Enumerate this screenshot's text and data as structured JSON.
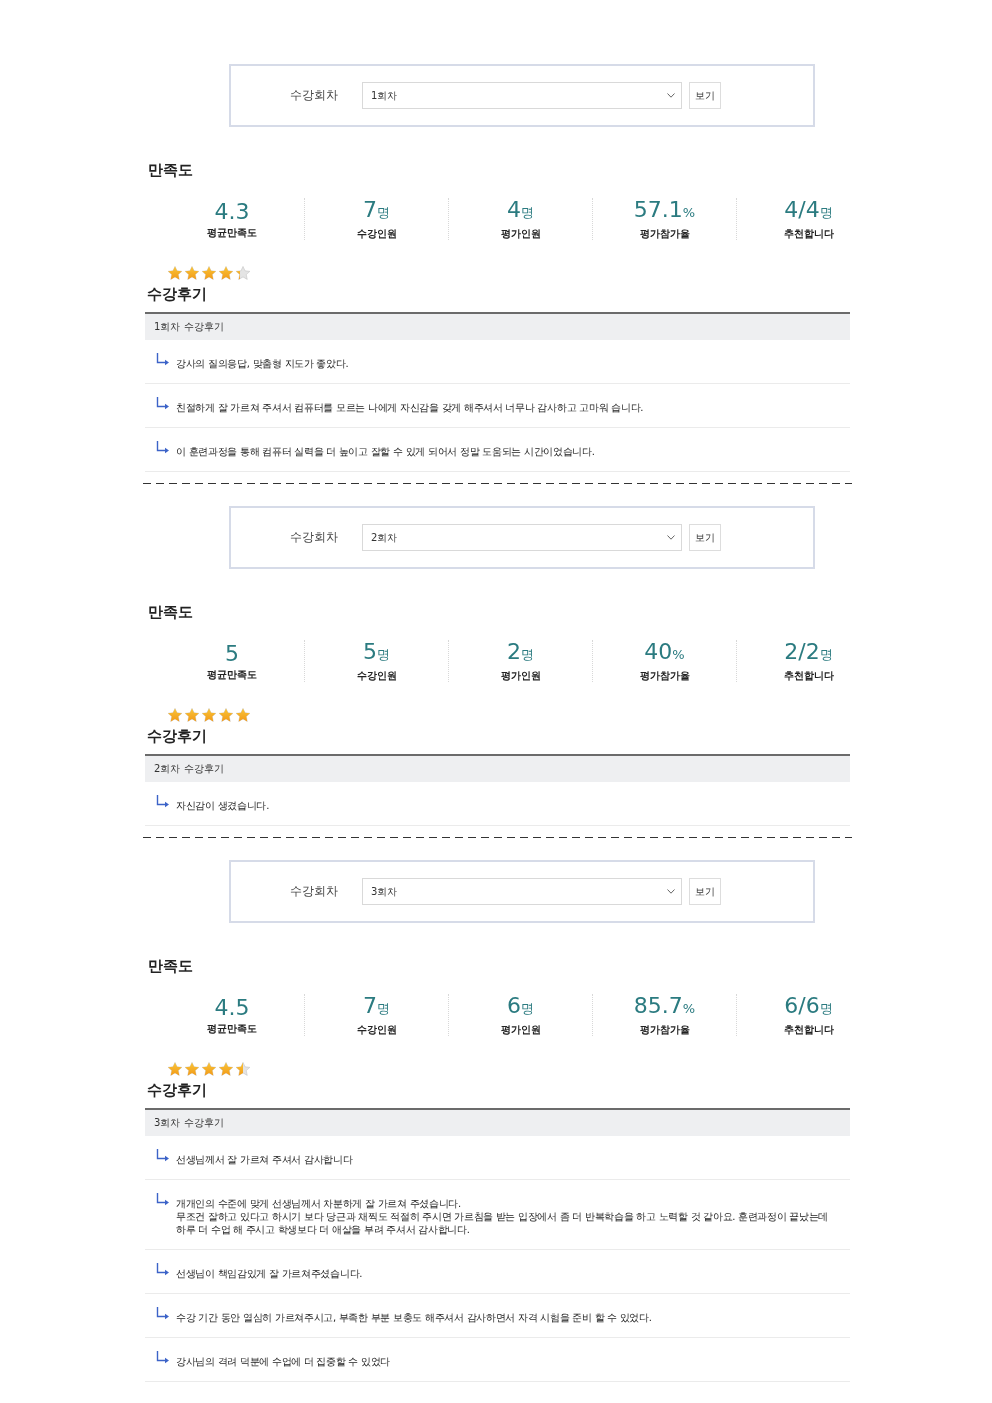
{
  "sessions": [
    {
      "filter": {
        "label": "수강회차",
        "value": "1회차",
        "button": "보기"
      },
      "satisfaction": {
        "title": "만족도",
        "stats": [
          {
            "value": "4.3",
            "label": "평균만족도"
          },
          {
            "value": "7",
            "unit": "명",
            "label": "수강인원"
          },
          {
            "value": "4",
            "unit": "명",
            "label": "평가인원"
          },
          {
            "value": "57.1",
            "unit": "%",
            "label": "평가참가율"
          },
          {
            "value": "4/4",
            "unit": "명",
            "label": "추천합니다"
          }
        ]
      },
      "rating": {
        "stars": 4.3
      },
      "reviews": {
        "title": "수강후기",
        "header": "1회차 수강후기",
        "items": [
          "강사의 질의응답, 맞춤형 지도가 좋았다.",
          "친절하게 잘 가르쳐 주셔서 컴퓨터를 모르는 나에게 자신감을 갖게 해주셔서 너무나 감사하고 고마워 습니다.",
          "이 훈련과정을 통해 컴퓨터 실력을 더 높이고 잘할 수 있게 되어서 정말 도움되는 시간이었습니다."
        ]
      }
    },
    {
      "filter": {
        "label": "수강회차",
        "value": "2회차",
        "button": "보기"
      },
      "satisfaction": {
        "title": "만족도",
        "stats": [
          {
            "value": "5",
            "label": "평균만족도"
          },
          {
            "value": "5",
            "unit": "명",
            "label": "수강인원"
          },
          {
            "value": "2",
            "unit": "명",
            "label": "평가인원"
          },
          {
            "value": "40",
            "unit": "%",
            "label": "평가참가율"
          },
          {
            "value": "2/2",
            "unit": "명",
            "label": "추천합니다"
          }
        ]
      },
      "rating": {
        "stars": 5
      },
      "reviews": {
        "title": "수강후기",
        "header": "2회차 수강후기",
        "items": [
          "자신감이 생겼습니다."
        ]
      }
    },
    {
      "filter": {
        "label": "수강회차",
        "value": "3회차",
        "button": "보기"
      },
      "satisfaction": {
        "title": "만족도",
        "stats": [
          {
            "value": "4.5",
            "label": "평균만족도"
          },
          {
            "value": "7",
            "unit": "명",
            "label": "수강인원"
          },
          {
            "value": "6",
            "unit": "명",
            "label": "평가인원"
          },
          {
            "value": "85.7",
            "unit": "%",
            "label": "평가참가율"
          },
          {
            "value": "6/6",
            "unit": "명",
            "label": "추천합니다"
          }
        ]
      },
      "rating": {
        "stars": 4.5
      },
      "reviews": {
        "title": "수강후기",
        "header": "3회차 수강후기",
        "items": [
          "선생님께서 잘 가르쳐 주셔서 감사합니다",
          "개개인의 수준에 맞게 선생님께서 차분하게 잘 가르쳐 주셨습니다.\n무조건 잘하고 있다고 하시기 보다 당근과 채찍도 적절히 주시면 가르침을 받는 입장에서 좀 더 반복학습을 하고 노력할 것 같아요. 훈련과정이 끝났는데 하루 더 수업 해 주시고 학생보다 더 애살을 부려 주셔서 감사합니다.",
          "선생님이 책임감있게 잘 가르쳐주셨습니다.",
          "수강 기간 동안 열심히 가르쳐주시고, 부족한 부분 보충도 해주셔서 감사하면서 자격 시험을 준비 할 수 있었다.",
          "강사님의 격려 덕분에 수업에 더 집중할 수 있었다"
        ]
      }
    }
  ]
}
